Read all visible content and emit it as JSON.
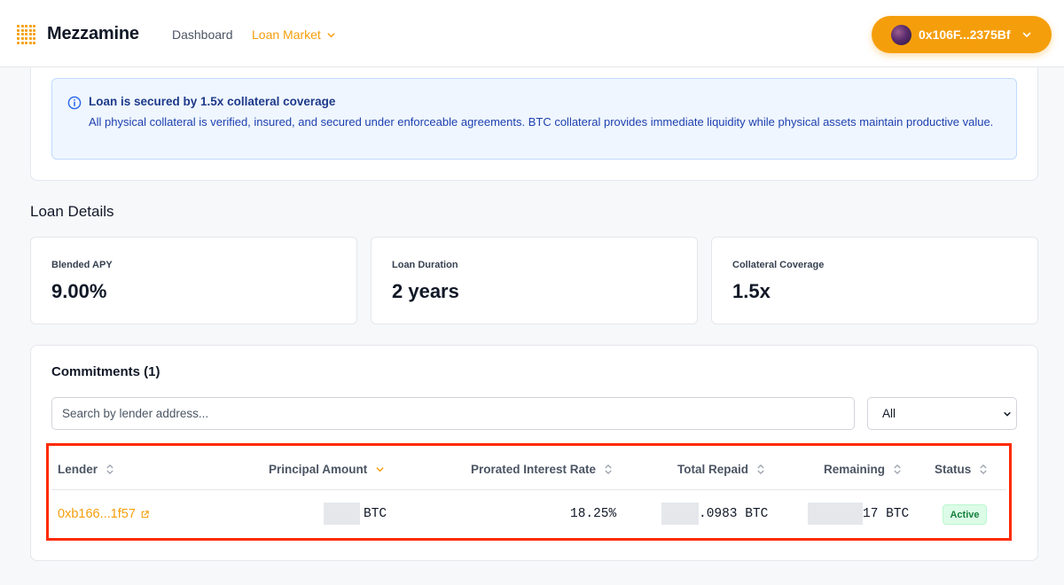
{
  "header": {
    "brand": "Mezzamine",
    "nav": {
      "dashboard": "Dashboard",
      "loan_market": "Loan Market"
    },
    "wallet_address": "0x106F...2375Bf",
    "accent_color": "#f59e0b"
  },
  "notice": {
    "title": "Loan is secured by 1.5x collateral coverage",
    "text": "All physical collateral is verified, insured, and secured under enforceable agreements. BTC collateral provides immediate liquidity while physical assets maintain productive value."
  },
  "loan_details": {
    "title": "Loan Details",
    "stats": [
      {
        "label": "Blended APY",
        "value": "9.00%"
      },
      {
        "label": "Loan Duration",
        "value": "2 years"
      },
      {
        "label": "Collateral Coverage",
        "value": "1.5x"
      }
    ]
  },
  "commitments": {
    "title": "Commitments (1)",
    "search_placeholder": "Search by lender address...",
    "filter_selected": "All",
    "columns": {
      "lender": "Lender",
      "principal": "Principal Amount",
      "rate": "Prorated Interest Rate",
      "repaid": "Total Repaid",
      "remaining": "Remaining",
      "status": "Status"
    },
    "rows": [
      {
        "lender": "0xb166...1f57",
        "principal": "BTC",
        "rate": "18.25%",
        "repaid": ".0983 BTC",
        "remaining": "17 BTC",
        "status": "Active"
      }
    ]
  }
}
